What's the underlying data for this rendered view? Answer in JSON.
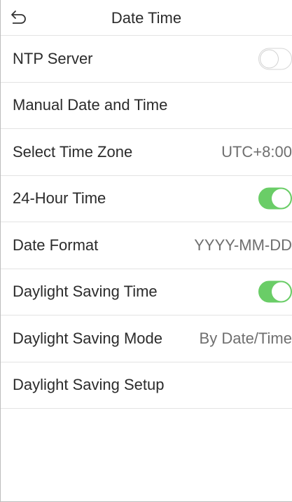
{
  "header": {
    "title": "Date Time",
    "back_icon": "back-arrow-icon"
  },
  "rows": [
    {
      "label": "NTP Server",
      "toggle": "off"
    },
    {
      "label": "Manual Date and Time"
    },
    {
      "label": "Select Time Zone",
      "value": "UTC+8:00"
    },
    {
      "label": "24-Hour Time",
      "toggle": "on"
    },
    {
      "label": "Date Format",
      "value": "YYYY-MM-DD"
    },
    {
      "label": "Daylight Saving Time",
      "toggle": "on"
    },
    {
      "label": "Daylight Saving Mode",
      "value": "By Date/Time"
    },
    {
      "label": "Daylight Saving Setup"
    }
  ],
  "colors": {
    "toggle_on": "#6acd67",
    "toggle_off_border": "#d6d6d6",
    "divider": "#e3e3e3"
  }
}
